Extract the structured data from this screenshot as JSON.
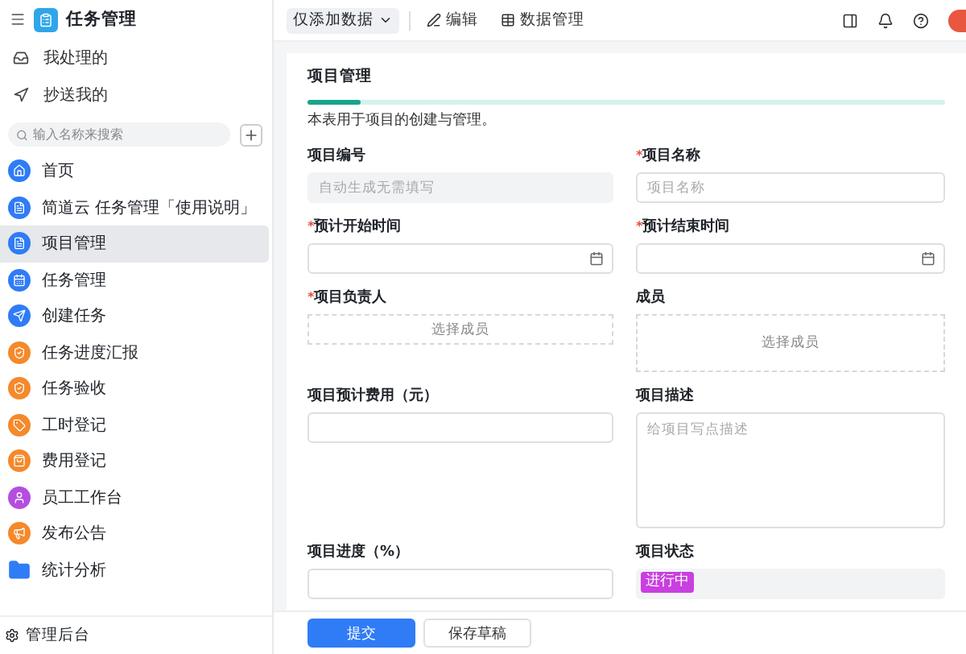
{
  "app": {
    "title": "任务管理"
  },
  "sidebar": {
    "top_items": [
      {
        "label": "我处理的"
      },
      {
        "label": "抄送我的"
      }
    ],
    "search": {
      "placeholder": "输入名称来搜索"
    },
    "items": [
      {
        "label": "首页",
        "kind": "circle",
        "color": "#2f7cf6",
        "selected": false
      },
      {
        "label": "简道云 任务管理「使用说明」",
        "kind": "circle",
        "color": "#2f7cf6",
        "selected": false
      },
      {
        "label": "项目管理",
        "kind": "circle",
        "color": "#2f7cf6",
        "selected": true
      },
      {
        "label": "任务管理",
        "kind": "circle",
        "color": "#2f7cf6",
        "selected": false
      },
      {
        "label": "创建任务",
        "kind": "circle",
        "color": "#2f7cf6",
        "selected": false
      },
      {
        "label": "任务进度汇报",
        "kind": "circle",
        "color": "#f5892b",
        "selected": false
      },
      {
        "label": "任务验收",
        "kind": "circle",
        "color": "#f5892b",
        "selected": false
      },
      {
        "label": "工时登记",
        "kind": "circle",
        "color": "#f5892b",
        "selected": false
      },
      {
        "label": "费用登记",
        "kind": "circle",
        "color": "#f5892b",
        "selected": false
      },
      {
        "label": "员工工作台",
        "kind": "circle",
        "color": "#b44ee0",
        "selected": false
      },
      {
        "label": "发布公告",
        "kind": "circle",
        "color": "#f5892b",
        "selected": false
      },
      {
        "label": "统计分析",
        "kind": "folder",
        "color": "#2f7cf6",
        "selected": false
      }
    ],
    "footer": "管理后台"
  },
  "toolbar": {
    "mode": "仅添加数据",
    "actions": [
      "编辑",
      "数据管理"
    ]
  },
  "form": {
    "title": "项目管理",
    "description": "本表用于项目的创建与管理。",
    "required_mark": "*",
    "fields": [
      {
        "label": "项目编号",
        "required": false,
        "kind": "text",
        "placeholder": "自动生成无需填写",
        "disabled": true
      },
      {
        "label": "项目名称",
        "required": true,
        "kind": "text",
        "placeholder": "项目名称",
        "disabled": false
      },
      {
        "label": "预计开始时间",
        "required": true,
        "kind": "date"
      },
      {
        "label": "预计结束时间",
        "required": true,
        "kind": "date"
      },
      {
        "label": "项目负责人",
        "required": true,
        "kind": "member",
        "prompt": "选择成员"
      },
      {
        "label": "成员",
        "required": false,
        "kind": "members",
        "prompt": "选择成员"
      },
      {
        "label": "项目预计费用（元）",
        "required": false,
        "kind": "text",
        "disabled": false
      },
      {
        "label": "项目描述",
        "required": false,
        "kind": "textarea",
        "placeholder": "给项目写点描述"
      },
      {
        "label": "项目进度（%）",
        "required": false,
        "kind": "text",
        "disabled": false
      },
      {
        "label": "项目状态",
        "required": false,
        "kind": "tag",
        "value": "进行中"
      }
    ]
  },
  "buttons": [
    {
      "label": "提交",
      "kind": "primary"
    },
    {
      "label": "保存草稿",
      "kind": "secondary"
    }
  ]
}
